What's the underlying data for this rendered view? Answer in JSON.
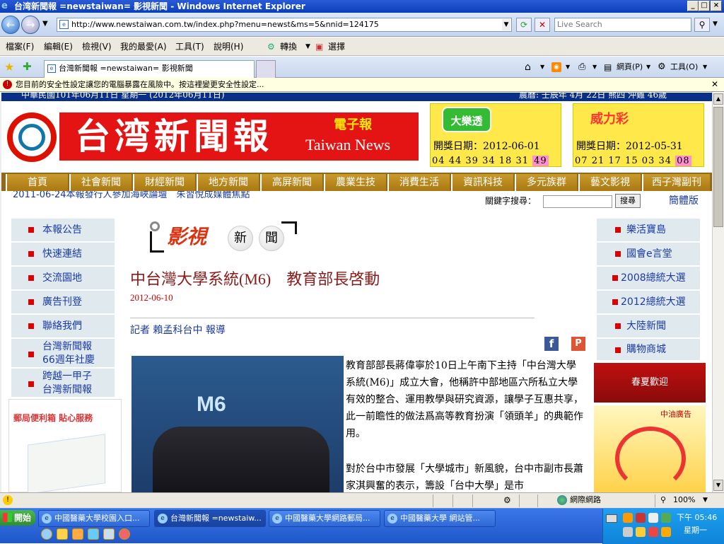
{
  "window": {
    "title": "台湾新聞報 =newstaiwan= 影視新聞 - Windows Internet Explorer"
  },
  "address": {
    "url": "http://www.newstaiwan.com.tw/index.php?menu=newst&ms=5&nnid=124175",
    "search_placeholder": "Live Search"
  },
  "menu": [
    "檔案(F)",
    "編輯(E)",
    "檢視(V)",
    "我的最愛(A)",
    "工具(T)",
    "說明(H)"
  ],
  "toolbar": {
    "convert": "轉換",
    "select": "選擇",
    "page": "網頁(P)",
    "tools": "工具(O)"
  },
  "tab": {
    "label": "台灣新聞報 =newstaiwan= 影視新聞"
  },
  "infobar": {
    "text": "您目前的安全性設定讓您的電腦暴露在風險中。按這裡變更安全性設定..."
  },
  "header": {
    "date_strip": "中華民國101年06月11日 星期一 (2012年06月11日)",
    "date_strip_right": "農曆: 壬辰年 4月 22日 熊四 沖雞 46歲",
    "banner_title": "台湾新聞報",
    "banner_edition": "電子報",
    "banner_en": "Taiwan News"
  },
  "lotto": [
    {
      "name": "大樂透",
      "draw_date": "開獎日期：2012-06-01",
      "numbers": [
        "04",
        "44",
        "39",
        "34",
        "18",
        "31"
      ],
      "special": "49"
    },
    {
      "name": "威力彩",
      "draw_date": "開獎日期：2012-05-31",
      "numbers": [
        "07",
        "21",
        "17",
        "15",
        "03",
        "34"
      ],
      "special": "08"
    }
  ],
  "nav": [
    "首頁",
    "社會新聞",
    "財經新聞",
    "地方新聞",
    "高屏新聞",
    "農業生技",
    "消費生活",
    "資訊科技",
    "多元族群",
    "藝文影視",
    "西子灣副刊"
  ],
  "ticker": "2011-06-24本報發行人參加海峽論壇　朱習悅成媒體焦點",
  "search": {
    "label": "關鍵字搜尋：",
    "button": "搜尋",
    "simplified": "簡體版"
  },
  "left_menu": [
    "本報公告",
    "快速連結",
    "交流園地",
    "廣告刊登",
    "聯絡我們",
    [
      "台灣新聞報",
      "66週年社慶"
    ],
    [
      "跨越一甲子",
      "台灣新聞報"
    ]
  ],
  "right_menu": [
    "樂活寶島",
    "國會e言堂",
    "2008總統大選",
    "2012總統大選",
    "大陸新聞",
    "購物商城"
  ],
  "section": {
    "name": "影視",
    "chars": [
      "新",
      "聞"
    ]
  },
  "article": {
    "title": "中台灣大學系統(M6)　教育部長啓動",
    "date": "2012-06-10",
    "reporter": "記者 賴孟科台中 報導",
    "photo_text": "M6",
    "para1": "教育部部長蔣偉寧於10日上午南下主持「中台灣大學系統(M6)」成立大會，他稱許中部地區六所私立大學有效的整合、運用教學與研究資源，讓學子互惠共享，此一前瞻性的做法爲高等教育扮演「領頭羊」的典範作用。",
    "para2": "對於台中市發展「大學城市」新風貌，台中市副市長蕭家淇興奮的表示，籌設「台中大學」是市"
  },
  "ads": {
    "left_title": "郵局便利箱 貼心服務",
    "right_top": "春夏歡迎",
    "right_bottom_label": "中油廣告"
  },
  "status": {
    "zone": "網際網路",
    "zoom": "100%"
  },
  "taskbar": {
    "start": "開始",
    "tasks": [
      "中國醫藥大學校園入口...",
      "台灣新聞報 =newstaiw...",
      "中國醫藥大學網路郵局...",
      "中國醫藥大學 網站管..."
    ],
    "time": "下午 05:46",
    "day": "星期一"
  }
}
